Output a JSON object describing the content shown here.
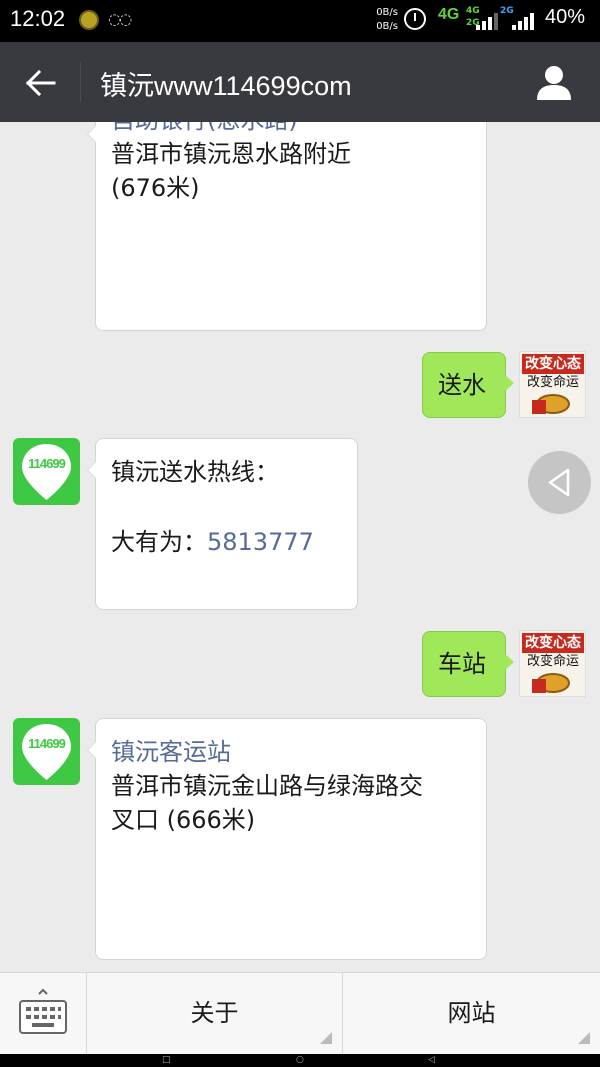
{
  "status_bar": {
    "time": "12:02",
    "net_up": "0B/s",
    "net_down": "0B/s",
    "network_primary": "4G",
    "network_secondary_top": "4G",
    "network_secondary_bottom": "2G",
    "network_tertiary": "2G",
    "battery": "40%"
  },
  "header": {
    "title": "镇沅www114699com"
  },
  "messages": [
    {
      "side": "left",
      "link": "自助银行(恩水路)",
      "text": "普洱市镇沅恩水路附近",
      "text2": "(676米)"
    },
    {
      "side": "right",
      "text": "送水"
    },
    {
      "side": "left",
      "line1": "镇沅送水热线：",
      "line2_prefix": "大有为：",
      "phone": "5813777"
    },
    {
      "side": "right",
      "text": "车站"
    },
    {
      "side": "left",
      "link": "镇沅客运站",
      "text": "普洱市镇沅金山路与绿海路交",
      "text2": "叉口 (666米)"
    }
  ],
  "user_avatar": {
    "line1": "改变心态",
    "line2": "改变命运"
  },
  "bot_avatar": {
    "label": "114699",
    "color": "#3ec843"
  },
  "bottom_menu": {
    "items": [
      "关于",
      "网站"
    ]
  },
  "colors": {
    "header_bg": "#393a3f",
    "right_bubble": "#a0e759",
    "link": "#576b95"
  }
}
